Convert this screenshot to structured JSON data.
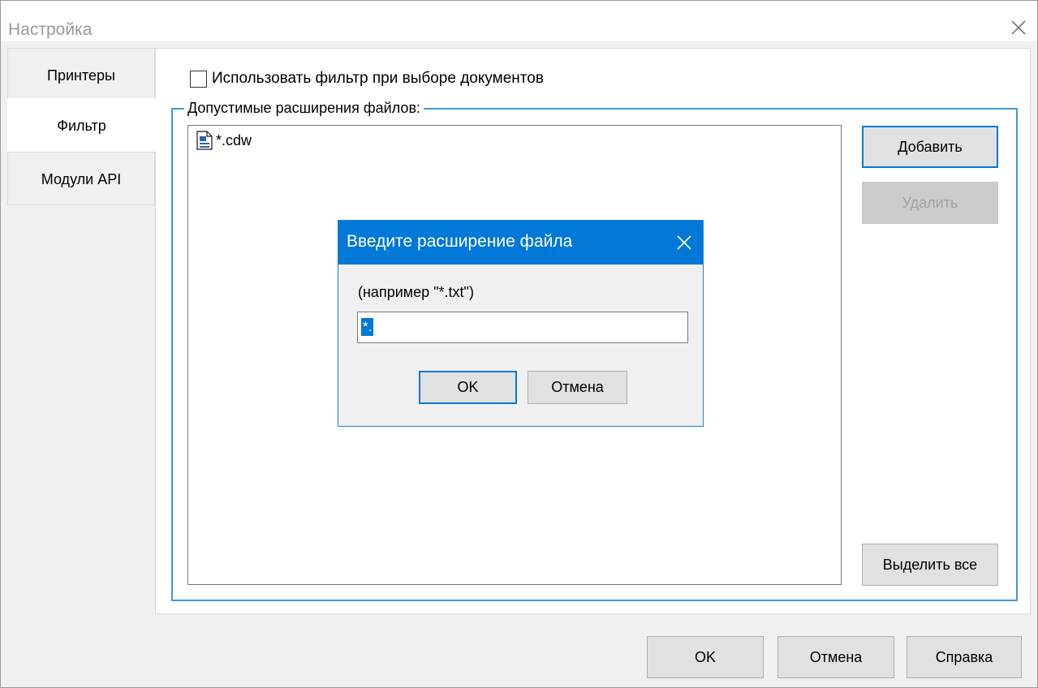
{
  "window": {
    "title": "Настройка"
  },
  "tabs": [
    {
      "label": "Принтеры",
      "active": false
    },
    {
      "label": "Фильтр",
      "active": true
    },
    {
      "label": "Модули API",
      "active": false
    }
  ],
  "filter": {
    "use_filter_label": "Использовать фильтр при выборе документов",
    "use_filter_checked": false,
    "group_title": "Допустимые расширения файлов:",
    "extensions": [
      {
        "label": "*.cdw",
        "icon": "document-icon"
      }
    ],
    "add_label": "Добавить",
    "delete_label": "Удалить",
    "select_all_label": "Выделить все"
  },
  "footer": {
    "ok_label": "OK",
    "cancel_label": "Отмена",
    "help_label": "Справка"
  },
  "dialog": {
    "title": "Введите расширение файла",
    "hint": "(например \"*.txt\")",
    "input_value": "*.",
    "ok_label": "OK",
    "cancel_label": "Отмена"
  },
  "colors": {
    "accent": "#0078d7",
    "group_border": "#3c9ae0"
  }
}
